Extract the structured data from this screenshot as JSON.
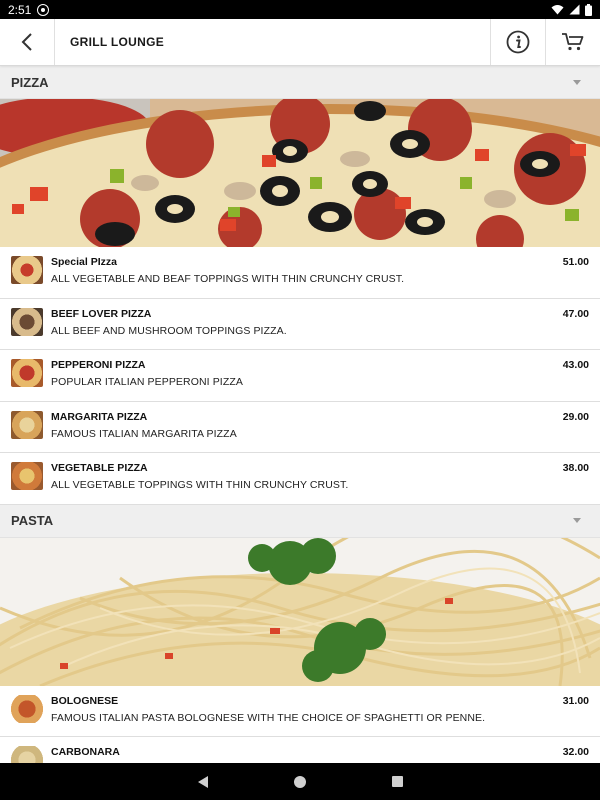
{
  "status_bar": {
    "time": "2:51"
  },
  "app_bar": {
    "title": "GRILL LOUNGE"
  },
  "sections": [
    {
      "title": "PIZZA",
      "items": [
        {
          "name": "Special PIzza",
          "description": "ALL VEGETABLE AND BEAF TOPPINGS WITH THIN CRUNCHY CRUST.",
          "price": "51.00"
        },
        {
          "name": "BEEF LOVER PIZZA",
          "description": "ALL BEEF AND MUSHROOM TOPPINGS PIZZA.",
          "price": "47.00"
        },
        {
          "name": "PEPPERONI PIZZA",
          "description": "POPULAR ITALIAN PEPPERONI PIZZA",
          "price": "43.00"
        },
        {
          "name": "MARGARITA PIZZA",
          "description": "FAMOUS ITALIAN MARGARITA PIZZA",
          "price": "29.00"
        },
        {
          "name": "VEGETABLE PIZZA",
          "description": "ALL VEGETABLE TOPPINGS WITH THIN CRUNCHY CRUST.",
          "price": "38.00"
        }
      ]
    },
    {
      "title": "PASTA",
      "items": [
        {
          "name": "BOLOGNESE",
          "description": "FAMOUS ITALIAN PASTA BOLOGNESE WITH THE CHOICE OF SPAGHETTI OR PENNE.",
          "price": "31.00"
        },
        {
          "name": "CARBONARA",
          "description": "",
          "price": "32.00"
        }
      ]
    }
  ],
  "icons": {
    "back": "back-arrow-icon",
    "info": "info-icon",
    "cart": "cart-icon",
    "section_toggle": "caret-down-icon"
  },
  "colors": {
    "section_bg": "#efefef",
    "divider": "#dedede",
    "status_bar": "#000000"
  }
}
